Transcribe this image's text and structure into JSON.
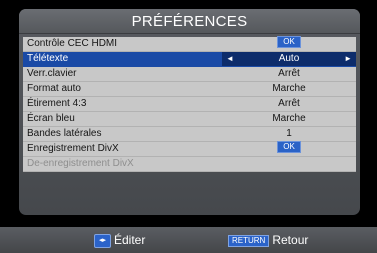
{
  "header": {
    "title": "PRÉFÉRENCES"
  },
  "rows": [
    {
      "label": "Contrôle CEC HDMI",
      "value": "OK"
    },
    {
      "label": "Télétexte",
      "value": "Auto"
    },
    {
      "label": "Verr.clavier",
      "value": "Arrêt"
    },
    {
      "label": "Format auto",
      "value": "Marche"
    },
    {
      "label": "Étirement 4:3",
      "value": "Arrêt"
    },
    {
      "label": "Écran bleu",
      "value": "Marche"
    },
    {
      "label": "Bandes latérales",
      "value": "1"
    },
    {
      "label": "Enregistrement DivX",
      "value": "OK"
    },
    {
      "label": "De-enregistrement DivX",
      "value": ""
    }
  ],
  "selector": {
    "left_arrow": "◄",
    "right_arrow": "►"
  },
  "footer": {
    "edit_icon": "◂▸",
    "edit_label": "Éditer",
    "return_key": "RETURN",
    "back_label": "Retour"
  },
  "colors": {
    "selected": "#1a4aa6",
    "ok_badge": "#2a62c7"
  },
  "icons": {
    "edit": "dpad-left-right-icon"
  }
}
